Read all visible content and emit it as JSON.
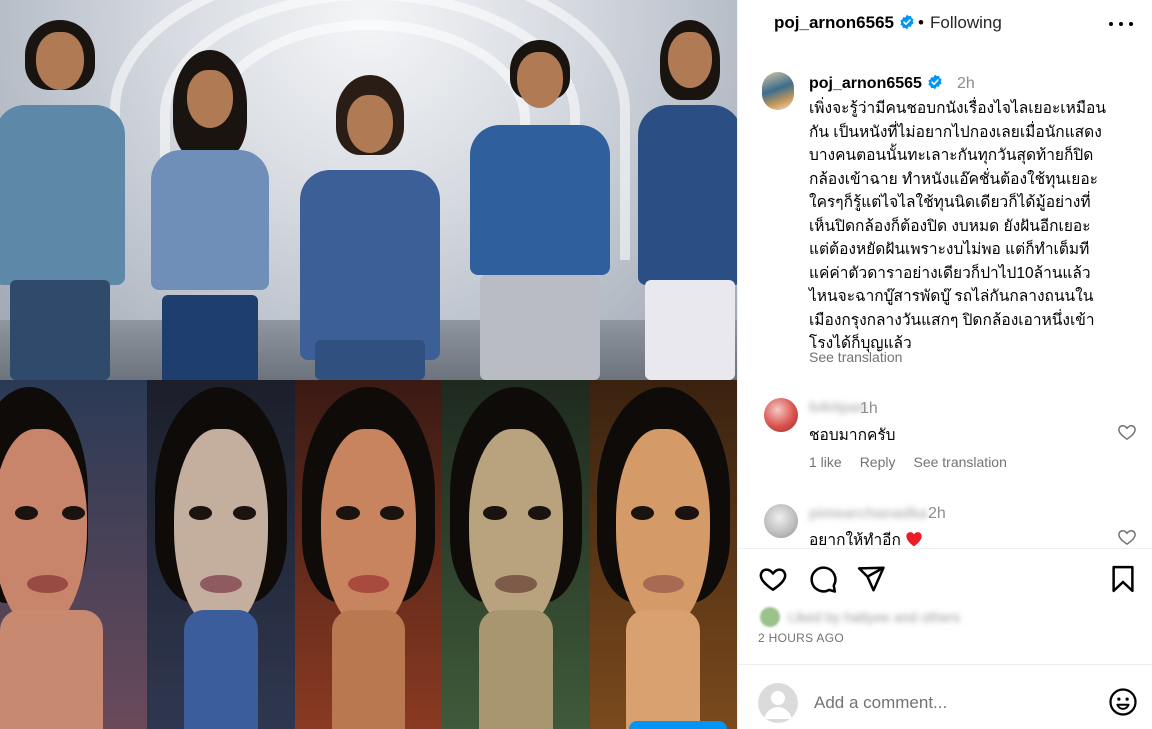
{
  "header": {
    "username": "poj_arnon6565",
    "separator": "•",
    "follow_state": "Following"
  },
  "caption": {
    "username": "poj_arnon6565",
    "time": "2h",
    "text": "เพิ่งจะรู้ว่ามีคนชอบกนังเรื่องไจไลเยอะเหมือน\nกัน เป็นหนังที่ไม่อยากไปกองเลยเมื่อนักแสดง\nบางคนตอนนั้นทะเลาะกันทุกวันสุดท้ายก็ปิด\nกล้องเข้าฉาย ทำหนังแอ๊คชั่นต้องใช้ทุนเยอะ\nใครๆก็รู้แต่ไจไลใช้ทุนนิดเดียวก็ได้มู้อย่างที่\nเห็นปิดกล้องก็ต้องปิด งบหมด ยังฝันอีกเยอะ\nแต่ต้องหยัดฝันเพราะงบไม่พอ แต่ก็ทำเต็มที\nแค่ค่าตัวดาราอย่างเดียวก็ปาไป10ล้านแล้ว\nไหนจะฉากบู๊สารพัดบู๊ รถไล่กันกลางถนนใน\nเมืองกรุงกลางวันแสกๆ ปิดกล้องเอาหนึ่งเข้า\nโรงได้ก็บุญแล้ว",
    "see_translation": "See translation"
  },
  "comments": [
    {
      "username": "b4t4pan",
      "time": "1h",
      "text": "ชอบมากครับ",
      "likes": "1 like",
      "reply": "Reply",
      "see_translation": "See translation"
    },
    {
      "username": "pimearchanadka",
      "time": "2h",
      "text": "อยากให้ทำอีก"
    }
  ],
  "likes_line": "Liked by hattyee and others",
  "post_time": "2 HOURS AGO",
  "add_comment": {
    "placeholder": "Add a comment..."
  },
  "icons": {
    "verified": "verified-badge-icon",
    "more": "more-options-icon",
    "like": "heart-icon",
    "comment": "comment-icon",
    "share": "share-icon",
    "save": "bookmark-icon",
    "emoji": "emoji-icon"
  },
  "colors": {
    "verified_blue": "#0095f6",
    "heart_red": "#ed1c24",
    "muted": "#737373"
  }
}
